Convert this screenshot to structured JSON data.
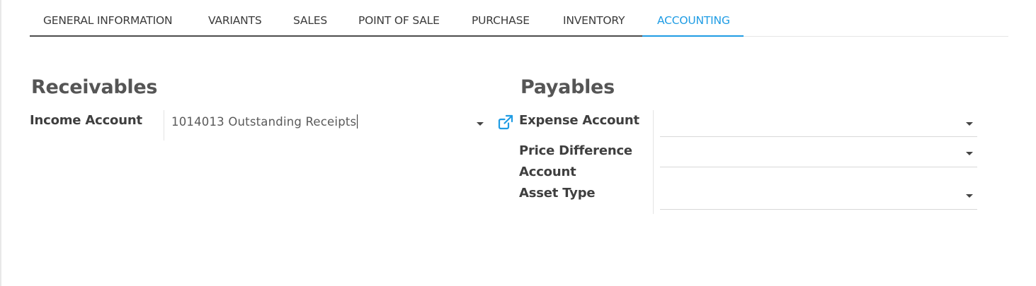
{
  "tabs": [
    {
      "label": "GENERAL INFORMATION"
    },
    {
      "label": "VARIANTS"
    },
    {
      "label": "SALES"
    },
    {
      "label": "POINT OF SALE"
    },
    {
      "label": "PURCHASE"
    },
    {
      "label": "INVENTORY"
    },
    {
      "label": "ACCOUNTING",
      "active": true
    }
  ],
  "receivables": {
    "title": "Receivables",
    "income_account": {
      "label": "Income Account",
      "value": "1014013 Outstanding Receipts"
    }
  },
  "payables": {
    "title": "Payables",
    "expense_account": {
      "label": "Expense Account",
      "value": ""
    },
    "price_difference_account": {
      "label_line1": "Price Difference",
      "label_line2": "Account",
      "value": ""
    },
    "asset_type": {
      "label": "Asset Type",
      "value": ""
    }
  },
  "colors": {
    "accent": "#1f9ce4",
    "text": "#3f3f3f"
  },
  "icons": {
    "external_link": "external-link-icon",
    "dropdown": "chevron-down-icon"
  }
}
